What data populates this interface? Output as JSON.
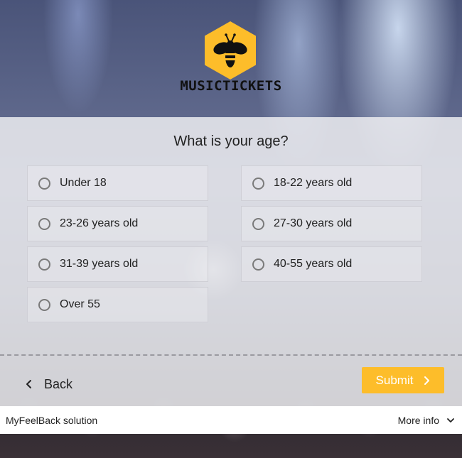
{
  "header": {
    "brand": "MUSICTICKETS",
    "logo_icon": "bee-icon",
    "logo_color": "#fdbd2a"
  },
  "survey": {
    "question": "What is your age?",
    "options": [
      {
        "label": "Under 18"
      },
      {
        "label": "18-22 years old"
      },
      {
        "label": "23-26 years old"
      },
      {
        "label": "27-30 years old"
      },
      {
        "label": "31-39 years old"
      },
      {
        "label": "40-55 years old"
      },
      {
        "label": "Over 55"
      }
    ]
  },
  "navigation": {
    "back_label": "Back",
    "back_icon": "chevron-left-icon",
    "submit_label": "Submit",
    "submit_icon": "chevron-right-icon",
    "submit_color": "#fdbd2a"
  },
  "footer": {
    "solution_text": "MyFeelBack solution",
    "more_info_label": "More info",
    "more_info_icon": "chevron-down-icon"
  }
}
